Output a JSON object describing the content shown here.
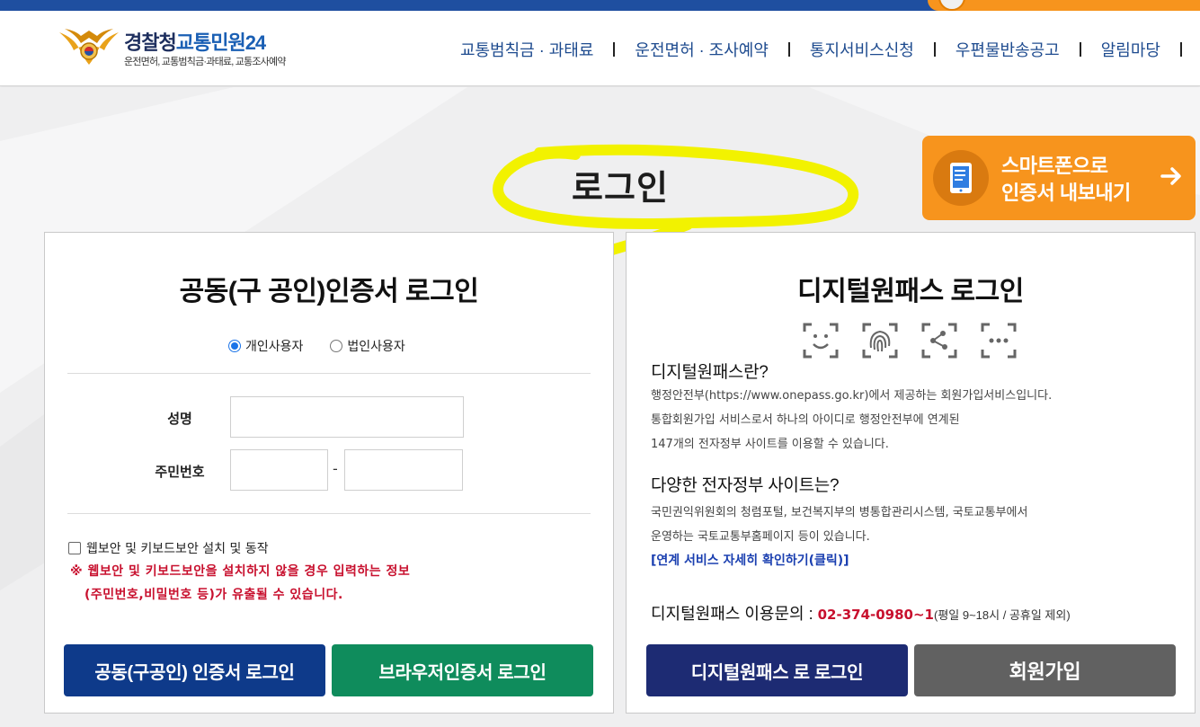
{
  "logo": {
    "title_part1": "경찰청",
    "title_part2": "교통민원24",
    "subtitle": "운전면허, 교통범칙금·과태료, 교통조사예약"
  },
  "nav": {
    "items": [
      {
        "label": "교통범칙금 · 과태료"
      },
      {
        "label": "운전면허 · 조사예약"
      },
      {
        "label": "통지서비스신청"
      },
      {
        "label": "우편물반송공고"
      },
      {
        "label": "알림마당"
      }
    ]
  },
  "page": {
    "title": "로그인"
  },
  "export": {
    "label": "스마트폰으로\n인증서 내보내기"
  },
  "cert_login": {
    "heading": "공동(구 공인)인증서 로그인",
    "radio_personal": "개인사용자",
    "radio_corporate": "법인사용자",
    "name_label": "성명",
    "rrn_label": "주민번호",
    "name_value": "",
    "rrn_front_value": "",
    "rrn_back_value": "",
    "dash": "-",
    "security_checkbox": "웹보안 및 키보드보안 설치 및 동작",
    "warning_line1": "※ 웹보안 및 키보드보안을 설치하지 않을 경우 입력하는 정보",
    "warning_line2": "(주민번호,비밀번호 등)가 유출될 수 있습니다.",
    "btn_cert": "공동(구공인) 인증서 로그인",
    "btn_browser": "브라우저인증서 로그인"
  },
  "onepass": {
    "heading": "디지털원패스 로그인",
    "what_title": "디지털원패스란?",
    "what_lines": [
      "행정안전부(https://www.onepass.go.kr)에서 제공하는 회원가입서비스입니다.",
      "통합회원가입 서비스로서 하나의 아이디로 행정안전부에 연계된",
      "147개의 전자정부 사이트를 이용할 수 있습니다."
    ],
    "sites_title": "다양한 전자정부 사이트는?",
    "sites_lines": [
      "국민권익위원회의 청렴포털, 보건복지부의 병통합관리시스템, 국토교통부에서",
      "운영하는 국토교통부홈페이지 등이 있습니다."
    ],
    "link": "[연계 서비스 자세히 확인하기(클릭)]",
    "contact_label": "디지털원패스 이용문의 : ",
    "contact_phone": "02-374-0980~1",
    "contact_hours": "(평일 9~18시 / 공휴일 제외)",
    "btn_login": "디지털원패스 로 로그인",
    "btn_signup": "회원가입"
  },
  "colors": {
    "header_blue": "#1f4fa0",
    "nav_text": "#1e4b8f",
    "orange": "#f7941d",
    "navy_button": "#0e3a8a",
    "green_button": "#0f8c5c",
    "onepass_button": "#1d2b73",
    "gray_button": "#616161",
    "warning_red": "#c8102e",
    "highlight_yellow": "#f2f200"
  },
  "icons": [
    "police-emblem-icon",
    "smartphone-icon",
    "arrow-right-icon",
    "face-scan-icon",
    "fingerprint-icon",
    "pattern-icon",
    "pin-icon"
  ]
}
